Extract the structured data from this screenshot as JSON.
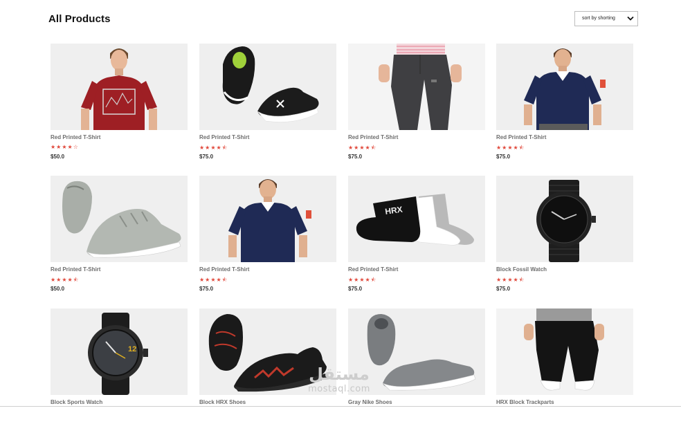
{
  "header": {
    "title": "All Products",
    "sort": {
      "label": "sort by shorting",
      "icon": "chevron-down-icon"
    }
  },
  "products": [
    {
      "name": "Red Printed T-Shirt",
      "stars": "★★★★☆",
      "price": "$50.0",
      "icon": "red-tshirt-model-image"
    },
    {
      "name": "Red Printed T-Shirt",
      "stars": "★★★★⯪",
      "price": "$75.0",
      "icon": "black-shoes-image"
    },
    {
      "name": "Red Printed T-Shirt",
      "stars": "★★★★⯪",
      "price": "$75.0",
      "icon": "gray-joggers-image"
    },
    {
      "name": "Red Printed T-Shirt",
      "stars": "★★★★⯪",
      "price": "$75.0",
      "icon": "navy-polo-model-image"
    },
    {
      "name": "Red Printed T-Shirt",
      "stars": "★★★★⯪",
      "price": "$50.0",
      "icon": "gray-sneakers-image"
    },
    {
      "name": "Red Printed T-Shirt",
      "stars": "★★★★⯪",
      "price": "$75.0",
      "icon": "navy-polo-model-image"
    },
    {
      "name": "Red Printed T-Shirt",
      "stars": "★★★★⯪",
      "price": "$75.0",
      "icon": "socks-image"
    },
    {
      "name": "Block Fossil Watch",
      "stars": "★★★★⯪",
      "price": "$75.0",
      "icon": "black-watch-image"
    },
    {
      "name": "Block Sports Watch",
      "stars": "",
      "price": "",
      "icon": "sports-watch-image"
    },
    {
      "name": "Block HRX Shoes",
      "stars": "",
      "price": "",
      "icon": "hrx-shoes-image"
    },
    {
      "name": "Gray Nike Shoes",
      "stars": "",
      "price": "",
      "icon": "gray-slipon-shoes-image"
    },
    {
      "name": "HRX Block Trackparts",
      "stars": "",
      "price": "",
      "icon": "black-trackpants-image"
    }
  ],
  "watermark": {
    "arabic": "مستقل",
    "latin": "mostaql.com"
  },
  "colors": {
    "star": "#e0473a",
    "card_bg": "#efefef",
    "name": "#6d6d6d"
  }
}
